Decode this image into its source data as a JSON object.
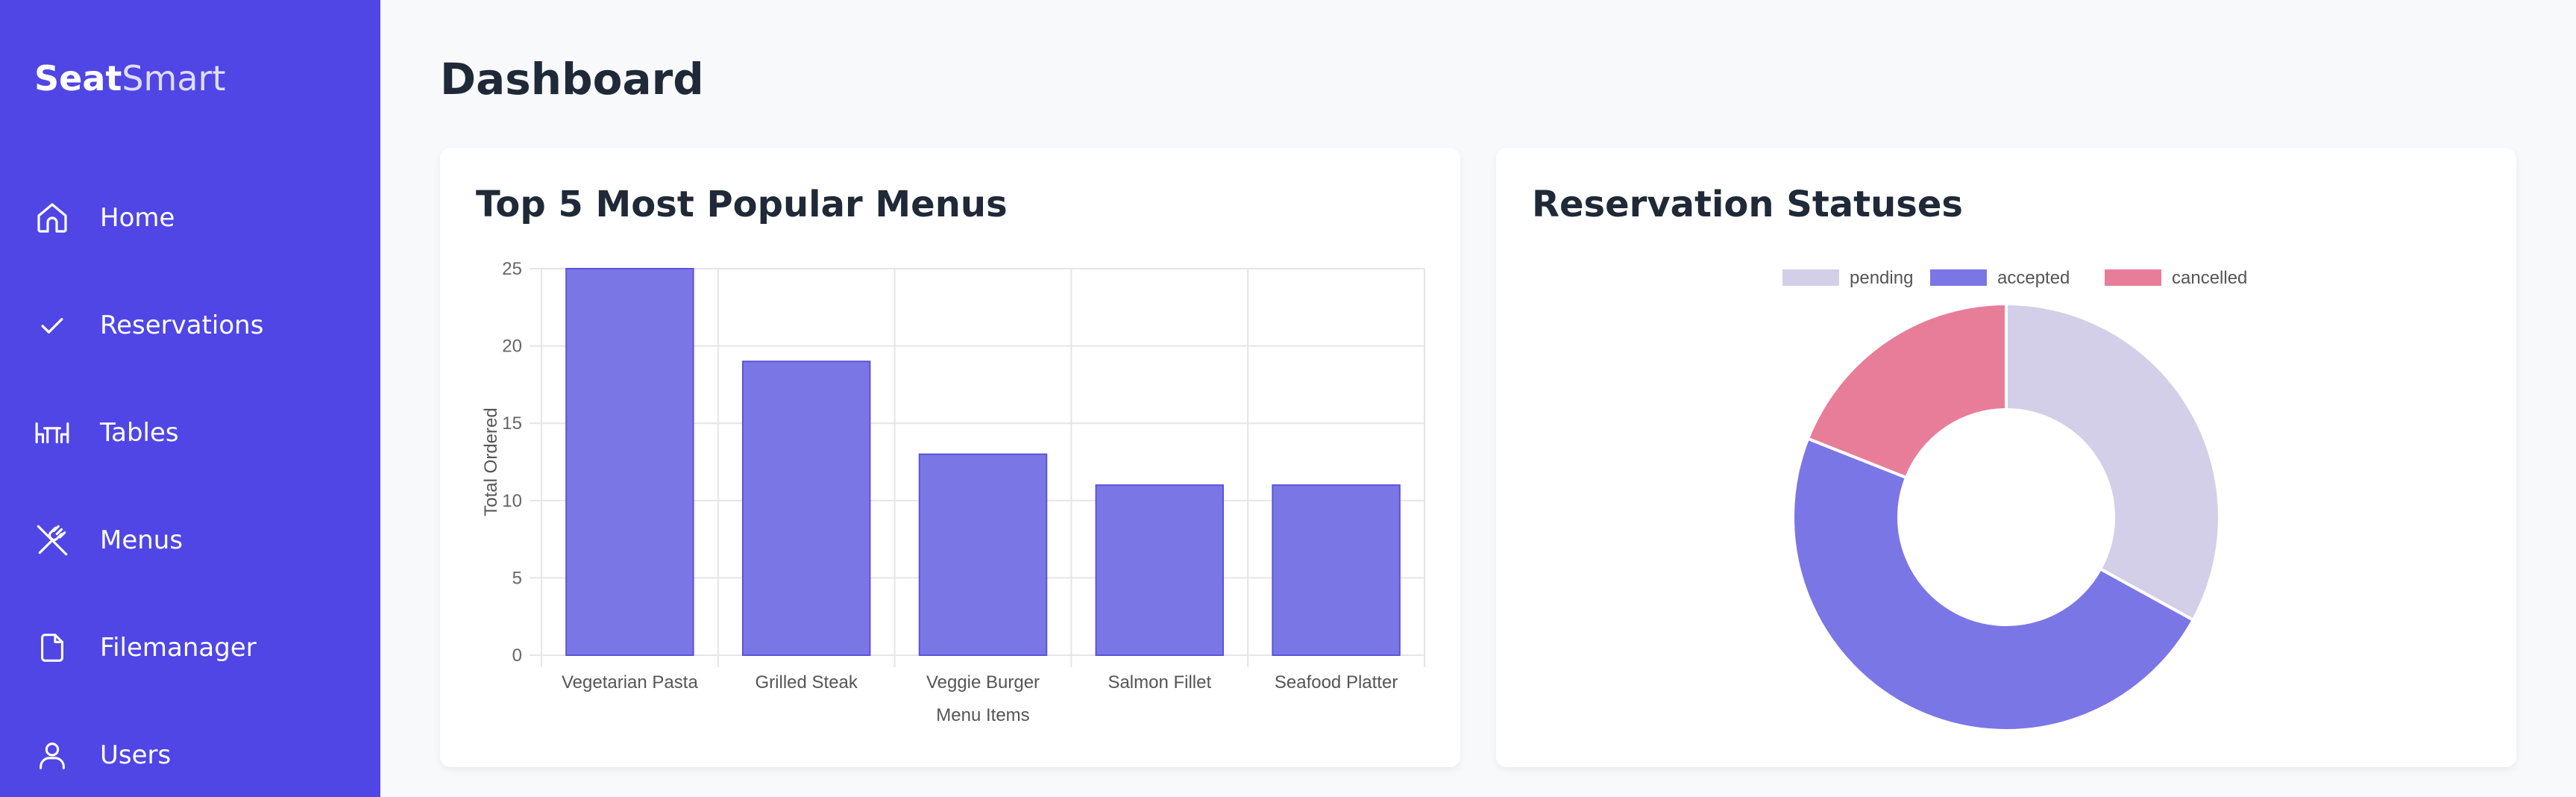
{
  "sidebar": {
    "brand_bold": "Seat",
    "brand_light": "Smart",
    "items": [
      {
        "label": "Home",
        "icon": "home-icon"
      },
      {
        "label": "Reservations",
        "icon": "check-icon"
      },
      {
        "label": "Tables",
        "icon": "table-icon"
      },
      {
        "label": "Menus",
        "icon": "fork-knife-icon"
      },
      {
        "label": "Filemanager",
        "icon": "file-icon"
      },
      {
        "label": "Users",
        "icon": "user-icon"
      }
    ]
  },
  "page": {
    "title": "Dashboard"
  },
  "colors": {
    "sidebar_bg": "#4f46e5",
    "bar": "#7b76e6",
    "pending": "#d4cfe8",
    "accepted": "#7b76e6",
    "cancelled": "#e87d9a"
  },
  "bar_card": {
    "title": "Top 5 Most Popular Menus"
  },
  "pie_card": {
    "title": "Reservation Statuses"
  },
  "chart_data": [
    {
      "type": "bar",
      "categories": [
        "Vegetarian Pasta",
        "Grilled Steak",
        "Veggie Burger",
        "Salmon Fillet",
        "Seafood Platter"
      ],
      "values": [
        25,
        19,
        13,
        11,
        11
      ],
      "title": "Top 5 Most Popular Menus",
      "xlabel": "Menu Items",
      "ylabel": "Total Ordered",
      "ylim": [
        0,
        25
      ],
      "yticks": [
        0,
        5,
        10,
        15,
        20,
        25
      ],
      "grid": true
    },
    {
      "type": "pie",
      "donut": true,
      "title": "Reservation Statuses",
      "labels": [
        "pending",
        "accepted",
        "cancelled"
      ],
      "values": [
        33,
        48,
        19
      ],
      "legend": "top"
    }
  ]
}
